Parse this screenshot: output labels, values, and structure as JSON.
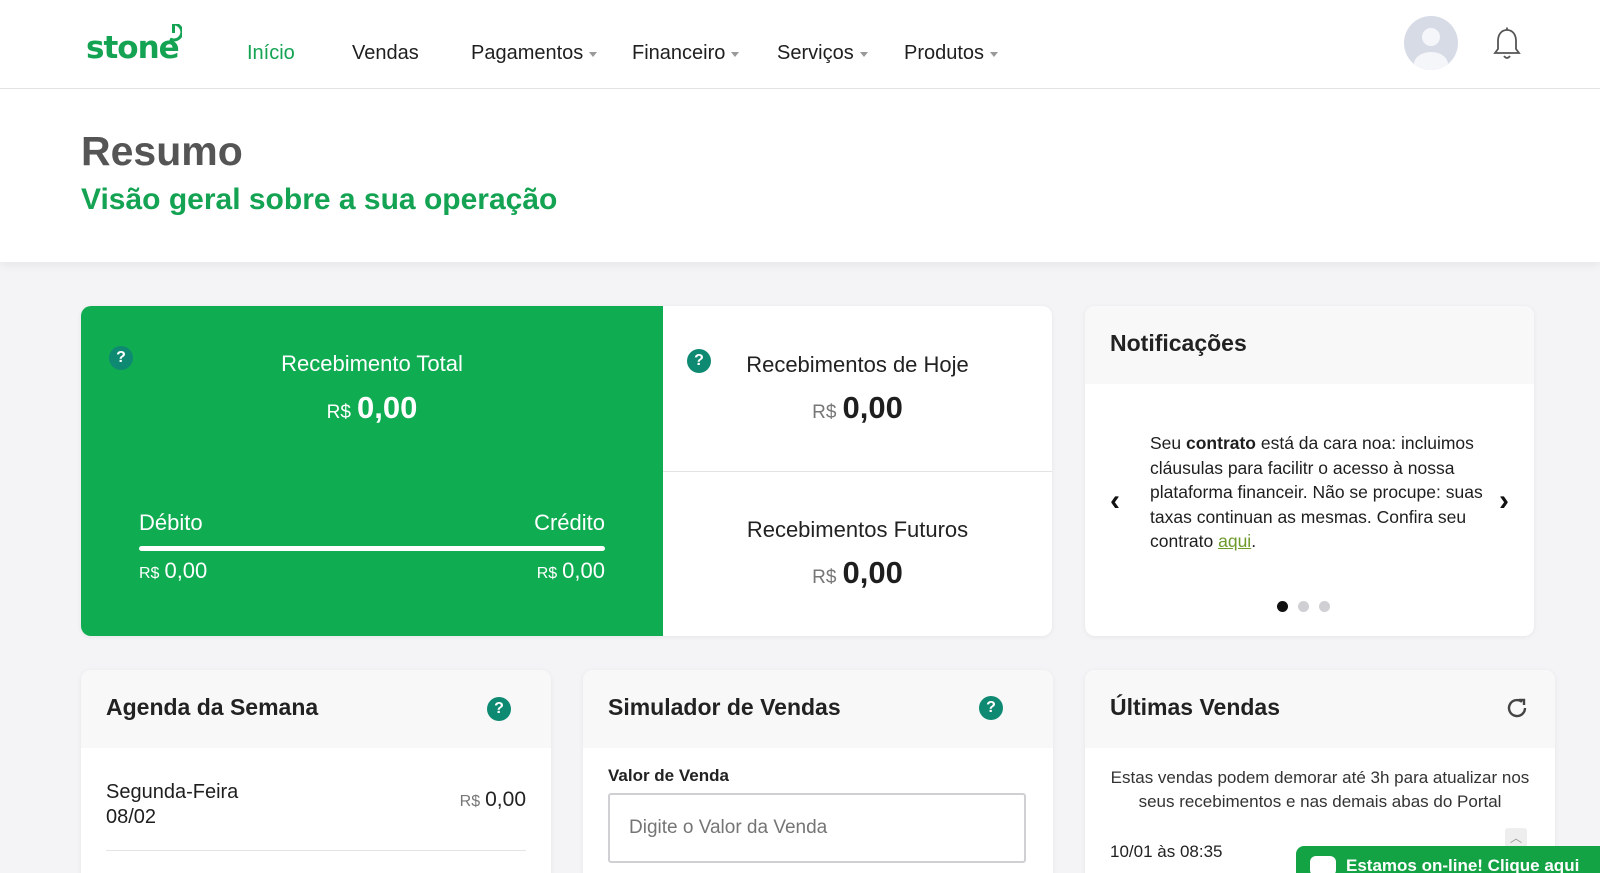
{
  "brand": {
    "logo_text": "stone",
    "accent": "#13a352",
    "panel_green": "#10ac51",
    "help_icon_color": "#0f8a72"
  },
  "nav": {
    "items": [
      {
        "label": "Início",
        "active": true,
        "dropdown": false
      },
      {
        "label": "Vendas",
        "active": false,
        "dropdown": false
      },
      {
        "label": "Pagamentos",
        "active": false,
        "dropdown": true
      },
      {
        "label": "Financeiro",
        "active": false,
        "dropdown": true
      },
      {
        "label": "Serviços",
        "active": false,
        "dropdown": true
      },
      {
        "label": "Produtos",
        "active": false,
        "dropdown": true
      }
    ],
    "icons": [
      "avatar-icon",
      "bell-icon"
    ]
  },
  "header": {
    "title": "Resumo",
    "subtitle": "Visão geral sobre a sua operação"
  },
  "receipts": {
    "total": {
      "label": "Recebimento Total",
      "currency": "R$",
      "value": "0,00"
    },
    "debit": {
      "label": "Débito",
      "currency": "R$",
      "value": "0,00"
    },
    "credit": {
      "label": "Crédito",
      "currency": "R$",
      "value": "0,00"
    },
    "today": {
      "label": "Recebimentos de Hoje",
      "currency": "R$",
      "value": "0,00"
    },
    "future": {
      "label": "Recebimentos Futuros",
      "currency": "R$",
      "value": "0,00"
    },
    "help_glyph": "?"
  },
  "notifications": {
    "title": "Notificações",
    "text_before": "Seu ",
    "text_bold": "contrato",
    "text_after": " está da cara noa: incluimos cláusulas para facilitr o acesso à nossa plataforma financeir. Não se procupe: suas taxas continuan as mesmas. Confira seu contrato ",
    "link": "aqui",
    "text_end": ".",
    "prev_glyph": "‹",
    "next_glyph": "›",
    "dots_active_index": 0,
    "dots_count": 3
  },
  "agenda": {
    "title": "Agenda da Semana",
    "day": "Segunda-Feira",
    "date": "08/02",
    "currency": "R$",
    "value": "0,00"
  },
  "simulator": {
    "title": "Simulador de Vendas",
    "field_label": "Valor de Venda",
    "placeholder": "Digite o Valor da Venda"
  },
  "sales": {
    "title": "Últimas Vendas",
    "note": "Estas vendas podem demorar até 3h para atualizar nos seus recebimentos e nas demais abas do Portal",
    "first_date": "10/01 às 08:35"
  },
  "chat": {
    "label": "Estamos on-line! Clique aqui"
  }
}
